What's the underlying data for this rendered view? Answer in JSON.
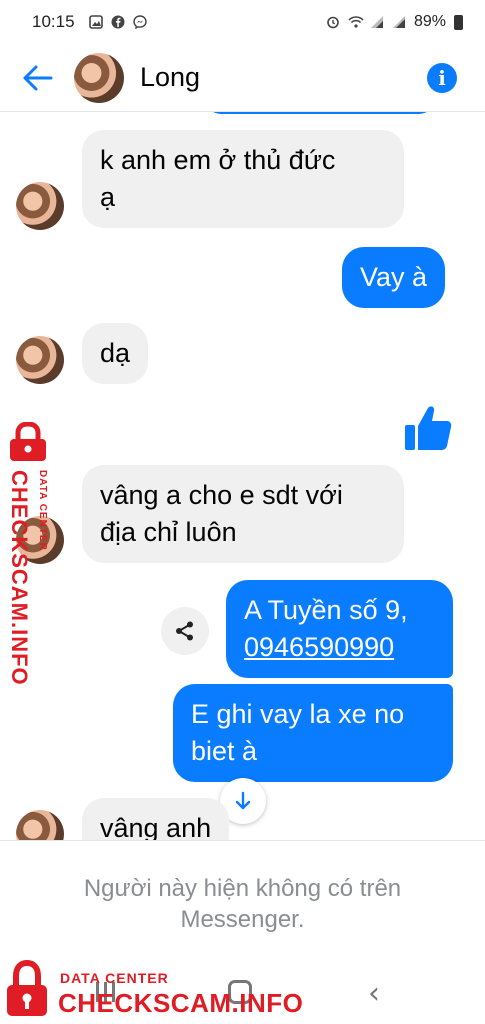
{
  "status_bar": {
    "time": "10:15",
    "battery": "89%",
    "left_icons": [
      "gallery-icon",
      "facebook-icon",
      "messenger-icon"
    ],
    "right_icons": [
      "alarm-icon",
      "wifi-icon",
      "signal-icon",
      "signal-icon",
      "battery-icon"
    ]
  },
  "header": {
    "contact_name": "Long"
  },
  "messages": {
    "m1": {
      "line1": "k anh em ở thủ đức",
      "line2": "ạ"
    },
    "m2": {
      "text": "Vay à"
    },
    "m3": {
      "text": "dạ"
    },
    "m4": {
      "like": "thumbs-up-icon"
    },
    "m5": {
      "line1": "vâng a cho e sdt với",
      "line2": "địa chỉ luôn"
    },
    "m6": {
      "line1": "A Tuyền số 9,",
      "line2": "0946590990"
    },
    "m7": {
      "line1": "E ghi vay la xe no",
      "line2": "biet à"
    },
    "m8": {
      "text": "vâng anh"
    }
  },
  "footer": {
    "notice": "Người này hiện không có trên Messenger."
  },
  "watermark": {
    "side_main": "CHECKSCAM.INFO",
    "side_sub": "DATA CENTER",
    "bottom_sub": "DATA CENTER",
    "bottom_main": "CHECKSCAM.INFO"
  },
  "colors": {
    "accent": "#0a7cff",
    "incoming_bubble": "#f0f0f0",
    "watermark": "#e01c24"
  }
}
